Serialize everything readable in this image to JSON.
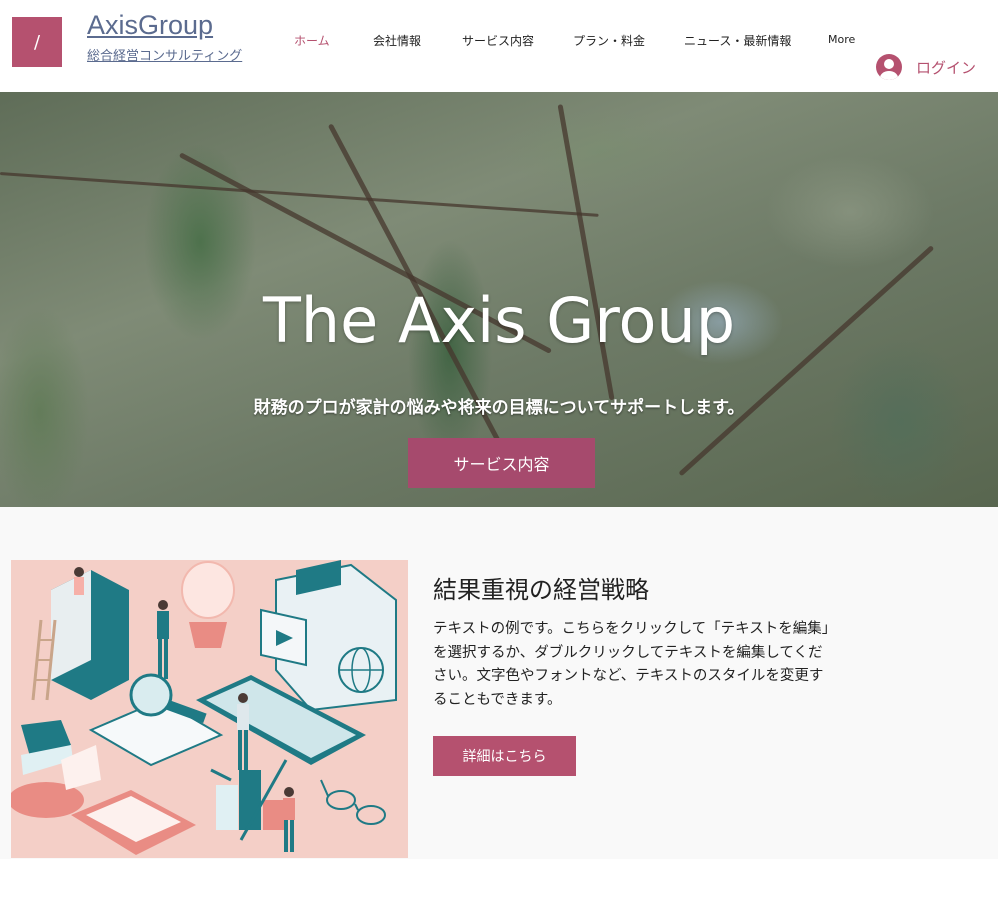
{
  "header": {
    "logo_glyph": "/",
    "brand": "AxisGroup",
    "tagline": "総合経営コンサルティング",
    "nav": [
      {
        "label": "ホーム",
        "active": true
      },
      {
        "label": "会社情報",
        "active": false
      },
      {
        "label": "サービス内容",
        "active": false
      },
      {
        "label": "プラン・料金",
        "active": false
      },
      {
        "label": "ニュース・最新情報",
        "active": false
      },
      {
        "label": "More",
        "active": false
      }
    ],
    "login_label": "ログイン"
  },
  "hero": {
    "title": "The Axis Group",
    "subtitle": "財務のプロが家計の悩みや将来の目標についてサポートします。",
    "button_label": "サービス内容"
  },
  "feature": {
    "title": "結果重視の経営戦略",
    "body": "テキストの例です。こちらをクリックして「テキストを編集」を選択するか、ダブルクリックしてテキストを編集してください。文字色やフォントなど、テキストのスタイルを変更することもできます。",
    "button_label": "詳細はこちら"
  },
  "colors": {
    "accent": "#b5516f",
    "hero_button": "#a64a6d",
    "illustration_bg": "#f4cfc7",
    "teal": "#1f7a85"
  }
}
